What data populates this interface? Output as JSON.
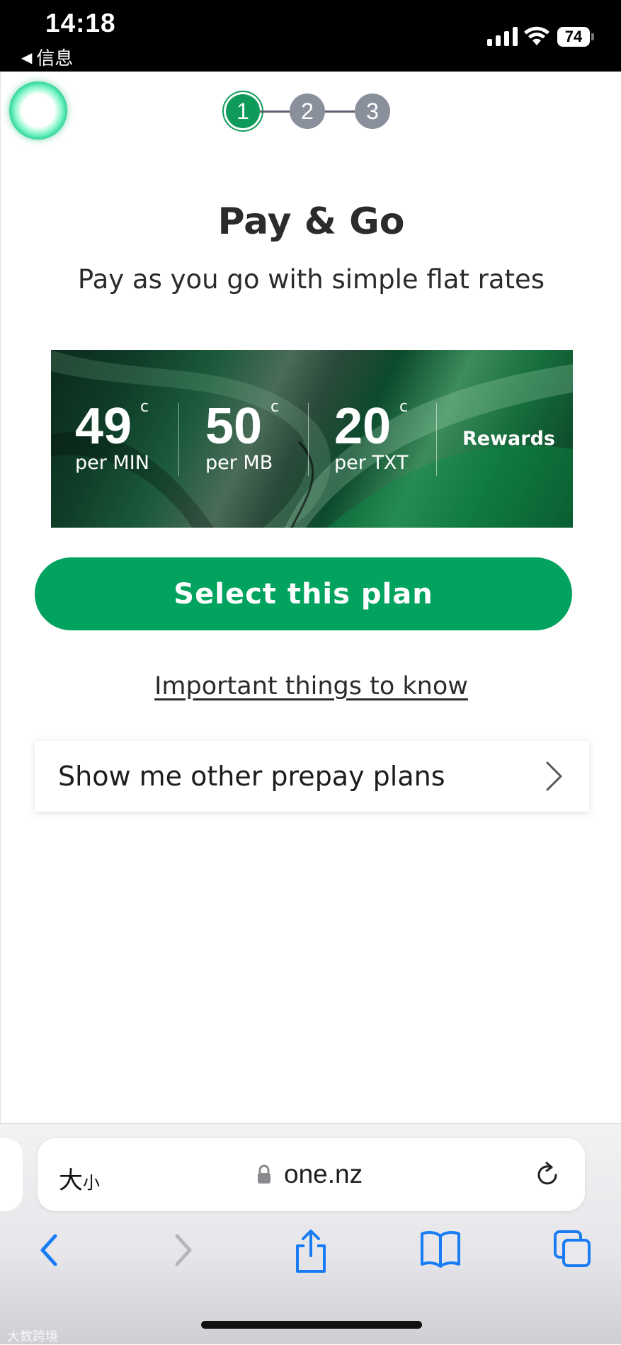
{
  "status_bar": {
    "time": "14:18",
    "back_label": "信息",
    "battery": "74"
  },
  "stepper": {
    "steps": [
      "1",
      "2",
      "3"
    ],
    "active": 1
  },
  "header": {
    "title": "Pay & Go",
    "subtitle": "Pay as you go with simple flat rates"
  },
  "rates": [
    {
      "value": "49",
      "unit": "c",
      "label": "per MIN"
    },
    {
      "value": "50",
      "unit": "c",
      "label": "per MB"
    },
    {
      "value": "20",
      "unit": "c",
      "label": "per TXT"
    }
  ],
  "rewards_label": "Rewards",
  "select_button": "Select this plan",
  "important_link": "Important things to know",
  "other_plans": "Show me other prepay plans",
  "browser": {
    "text_size": "大",
    "text_size_small": "小",
    "url": "one.nz"
  },
  "watermark": "大数跨境",
  "colors": {
    "brand_green": "#02a35e",
    "step_active": "#0e9b5a",
    "step_inactive": "#8a8f9c",
    "ios_blue": "#1a7cf5"
  }
}
